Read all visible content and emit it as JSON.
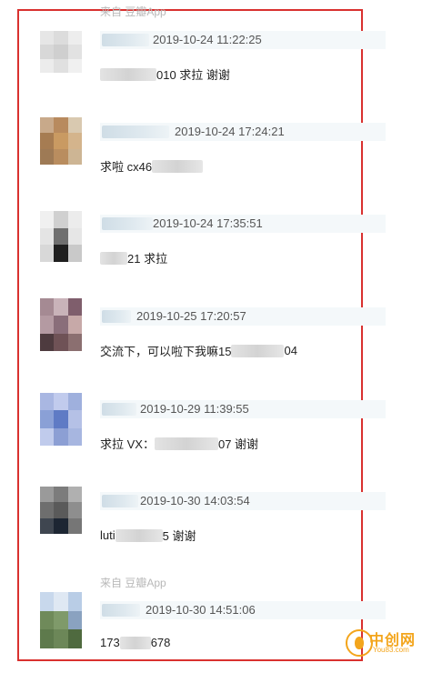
{
  "source_label": "来自 豆瓣App",
  "comments": [
    {
      "timestamp": "2019-10-24 11:22:25",
      "body_pre": "",
      "body_post": "010 求拉 谢谢",
      "avatar_colors": [
        "#e6e6e6",
        "#dcdcdc",
        "#ededed",
        "#d8d8d8",
        "#cfcfcf",
        "#e2e2e2",
        "#ececec",
        "#e0e0e0",
        "#f0f0f0"
      ]
    },
    {
      "timestamp": "2019-10-24 17:24:21",
      "body_pre": "求啦 cx46",
      "body_post": "",
      "avatar_colors": [
        "#c8a98a",
        "#b88a5e",
        "#d9c9b0",
        "#a67c52",
        "#c99a62",
        "#d4b48c",
        "#9e7a55",
        "#b98d5f",
        "#cdb594"
      ]
    },
    {
      "timestamp": "2019-10-24 17:35:51",
      "body_pre": "",
      "body_post": "21 求拉",
      "avatar_colors": [
        "#f0f0f0",
        "#d0d0d0",
        "#ececec",
        "#e4e4e4",
        "#6f6f6f",
        "#e6e6e6",
        "#d8d8d8",
        "#1f1f1f",
        "#c9c9c9"
      ]
    },
    {
      "timestamp": "2019-10-25 17:20:57",
      "body_pre": "交流下，可以啦下我嘛15",
      "body_post": "04",
      "avatar_colors": [
        "#a58a93",
        "#c9b3b9",
        "#7f5e6c",
        "#b49aa2",
        "#8a6e7a",
        "#c7a9a8",
        "#4e3b3f",
        "#6f5256",
        "#8b6f70"
      ]
    },
    {
      "timestamp": "2019-10-29 11:39:55",
      "body_pre": "求拉 VX：",
      "body_post": "07 谢谢",
      "avatar_colors": [
        "#a9b7e2",
        "#c1cbed",
        "#9fb0dd",
        "#8aa0d6",
        "#5f7bc5",
        "#b5c1e6",
        "#c0cbec",
        "#8c9fd4",
        "#a7b6e0"
      ]
    },
    {
      "timestamp": "2019-10-30 14:03:54",
      "body_pre": "luti",
      "body_post": "5 谢谢",
      "avatar_colors": [
        "#9a9a9a",
        "#7c7c7c",
        "#b0b0b0",
        "#6e6e6e",
        "#5a5a5a",
        "#8e8e8e",
        "#3f4650",
        "#1d2633",
        "#767676"
      ]
    },
    {
      "timestamp": "2019-10-30 14:51:06",
      "body_pre": "173",
      "body_post": "678",
      "avatar_colors": [
        "#c8d8ec",
        "#dfe8f3",
        "#b9cde6",
        "#6f8a5a",
        "#7f9a6a",
        "#8aa2c0",
        "#5e7a4c",
        "#6c8758",
        "#4f6a3f"
      ]
    }
  ],
  "watermark": {
    "title": "中创网",
    "subtitle": "You83.com"
  }
}
